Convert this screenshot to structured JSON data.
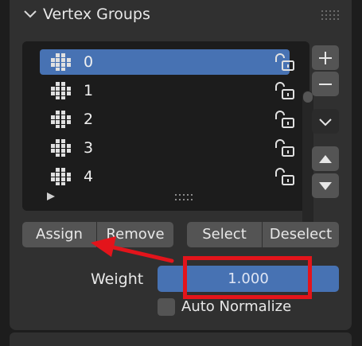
{
  "panel": {
    "title": "Vertex Groups",
    "collapse_icon": "chevron-down-icon",
    "drag_icon": "grip-dots-icon"
  },
  "vertex_groups": {
    "items": [
      {
        "label": "0",
        "selected": true,
        "locked": false
      },
      {
        "label": "1",
        "selected": false,
        "locked": false
      },
      {
        "label": "2",
        "selected": false,
        "locked": false
      },
      {
        "label": "3",
        "selected": false,
        "locked": false
      },
      {
        "label": "4",
        "selected": false,
        "locked": false
      }
    ],
    "item_icon": "vertex-group-icon",
    "lock_icon": "unlocked-padlock-icon"
  },
  "side_buttons": {
    "add_icon": "plus-icon",
    "remove_icon": "minus-icon",
    "specials_icon": "chevron-down-icon",
    "move_up_icon": "triangle-up-icon",
    "move_down_icon": "triangle-down-icon"
  },
  "actions": {
    "assign": "Assign",
    "remove": "Remove",
    "select": "Select",
    "deselect": "Deselect"
  },
  "weight": {
    "label": "Weight",
    "value": "1.000"
  },
  "auto_normalize": {
    "label": "Auto Normalize",
    "checked": false
  },
  "colors": {
    "accent": "#4772b3",
    "annotation": "#e3141b",
    "panel_bg": "#303030",
    "list_bg": "#1c1c1c",
    "button_bg": "#545454"
  }
}
